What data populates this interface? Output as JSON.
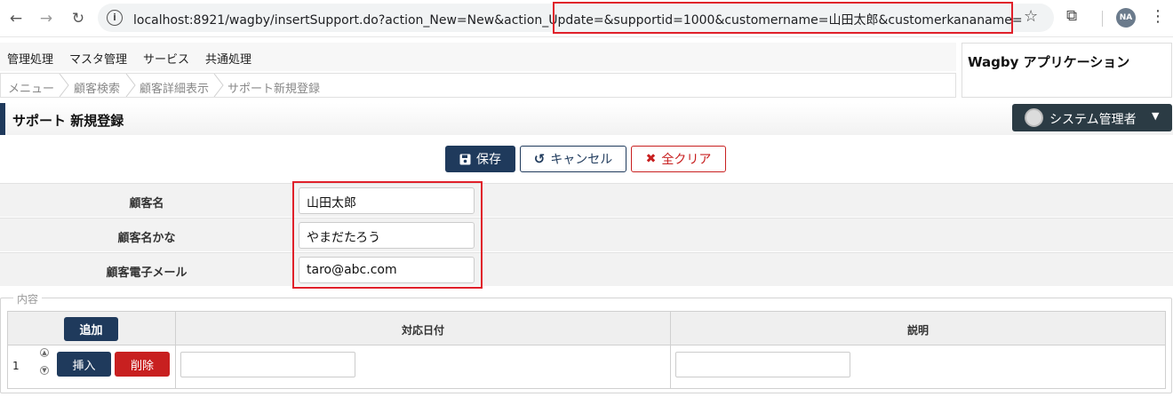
{
  "browser": {
    "url": "localhost:8921/wagby/insertSupport.do?action_New=New&action_Update=&supportid=1000&customername=山田太郎&customerkananame=やまだたろう&cu...",
    "profile_initials": "NA"
  },
  "menu": {
    "items": [
      "管理処理",
      "マスタ管理",
      "サービス",
      "共通処理"
    ]
  },
  "app_title": "Wagby アプリケーション",
  "breadcrumb": [
    "メニュー",
    "顧客検索",
    "顧客詳細表示",
    "サポート新規登録"
  ],
  "page_title": "サポート 新規登録",
  "user_menu": {
    "label": "システム管理者"
  },
  "actions": {
    "save": "保存",
    "cancel": "キャンセル",
    "clear": "全クリア"
  },
  "form": {
    "fields": [
      {
        "label": "顧客名",
        "value": "山田太郎"
      },
      {
        "label": "顧客名かな",
        "value": "やまだたろう"
      },
      {
        "label": "顧客電子メール",
        "value": "taro@abc.com"
      }
    ]
  },
  "content": {
    "legend": "内容",
    "add_label": "追加",
    "columns": [
      "対応日付",
      "説明"
    ],
    "rows": [
      {
        "index": "1",
        "insert_label": "挿入",
        "delete_label": "削除",
        "date": "",
        "description": ""
      }
    ]
  },
  "colors": {
    "primary": "#1f3a5c",
    "danger": "#c82020",
    "highlight": "#e0202a"
  }
}
